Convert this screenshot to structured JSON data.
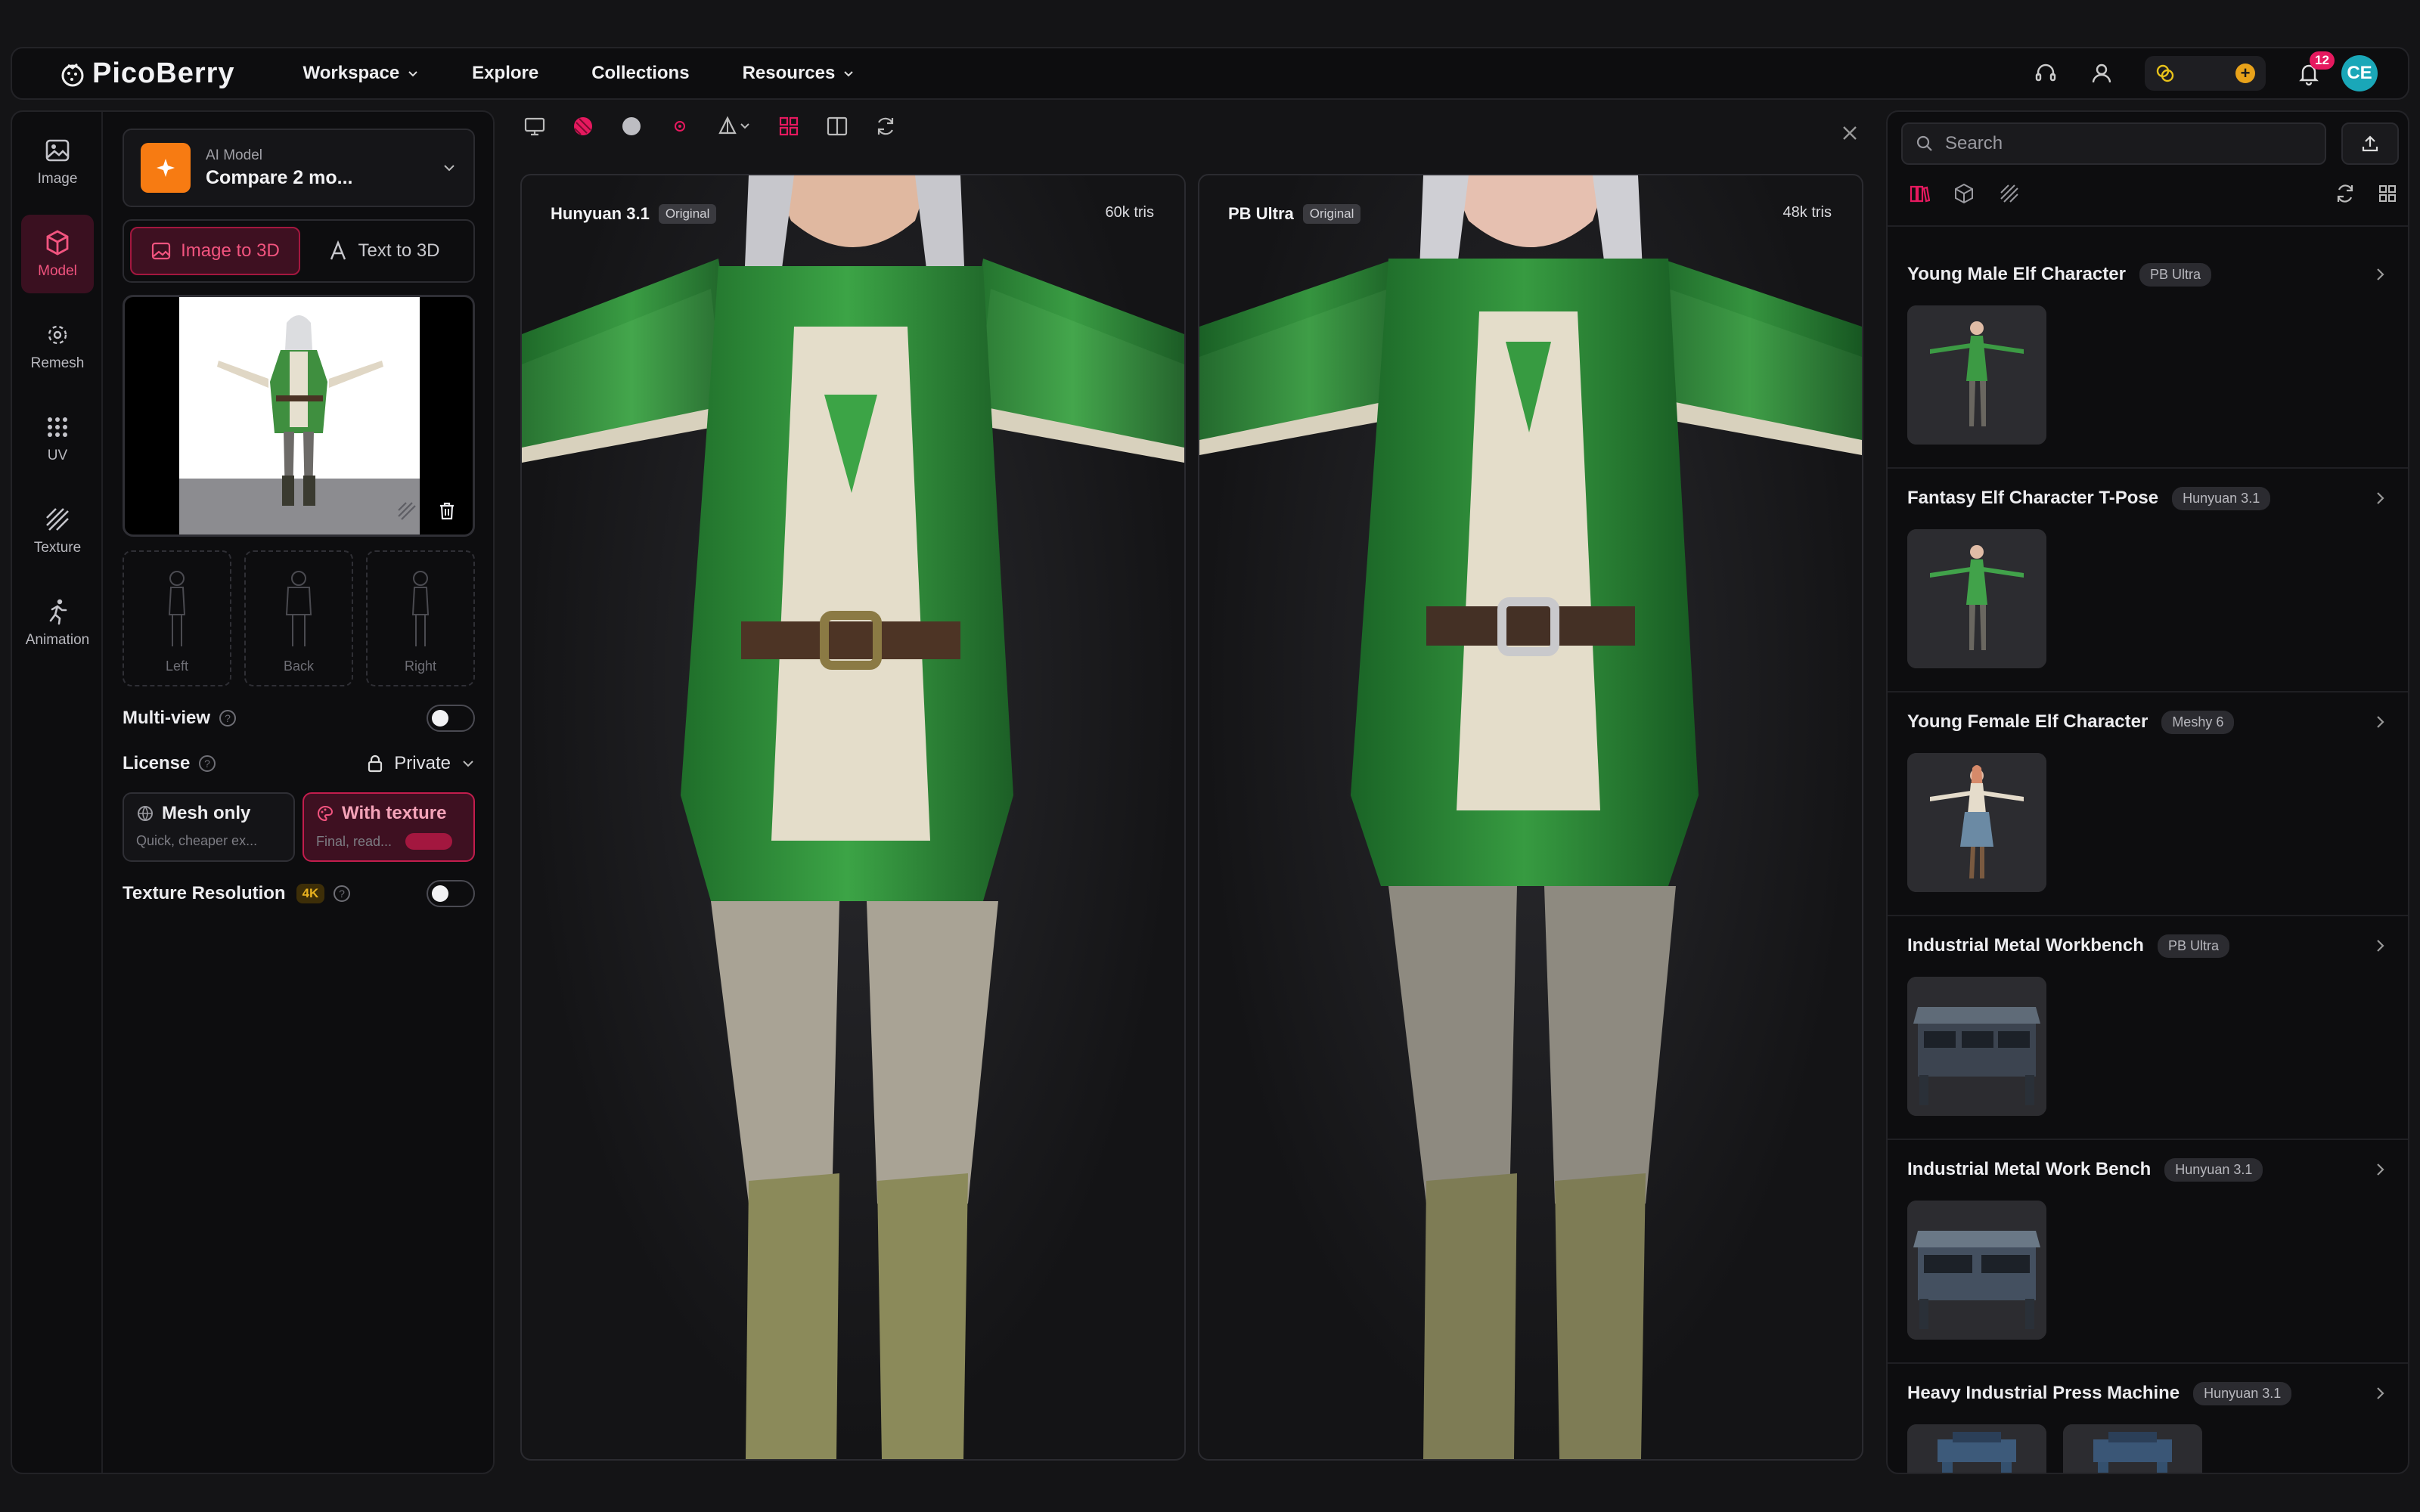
{
  "header": {
    "brand": "PicoBerry",
    "nav": [
      {
        "label": "Workspace",
        "dropdown": true
      },
      {
        "label": "Explore",
        "dropdown": false
      },
      {
        "label": "Collections",
        "dropdown": false
      },
      {
        "label": "Resources",
        "dropdown": true
      }
    ],
    "notifications_count": "12",
    "avatar_initials": "CE",
    "icons": [
      "headset-icon",
      "user-icon",
      "coin-icon",
      "plus-icon",
      "bell-icon"
    ]
  },
  "rail": {
    "items": [
      {
        "label": "Image",
        "icon": "image-icon",
        "active": false
      },
      {
        "label": "Model",
        "icon": "cube-icon",
        "active": true
      },
      {
        "label": "Remesh",
        "icon": "remesh-icon",
        "active": false
      },
      {
        "label": "UV",
        "icon": "grid-dots-icon",
        "active": false
      },
      {
        "label": "Texture",
        "icon": "texture-icon",
        "active": false
      },
      {
        "label": "Animation",
        "icon": "running-icon",
        "active": false
      }
    ]
  },
  "panel": {
    "model_small": "AI Model",
    "model_value": "Compare 2 mo...",
    "mode_image": "Image to 3D",
    "mode_text": "Text to 3D",
    "views": [
      "Left",
      "Back",
      "Right"
    ],
    "multiview_label": "Multi-view",
    "license_label": "License",
    "license_value": "Private",
    "mesh_only_title": "Mesh only",
    "mesh_only_desc": "Quick, cheaper ex...",
    "with_texture_title": "With texture",
    "with_texture_desc": "Final, read...",
    "texture_res_label": "Texture Resolution",
    "texture_res_badge": "4K"
  },
  "viewer": {
    "left": {
      "name": "Hunyuan 3.1",
      "tag": "Original",
      "tris": "60k tris"
    },
    "right": {
      "name": "PB Ultra",
      "tag": "Original",
      "tris": "48k tris"
    }
  },
  "library": {
    "search_placeholder": "Search",
    "items": [
      {
        "title": "Young Male Elf Character",
        "badge": "PB Ultra",
        "thumb": "elf-male"
      },
      {
        "title": "Fantasy Elf Character T-Pose",
        "badge": "Hunyuan 3.1",
        "thumb": "elf-male"
      },
      {
        "title": "Young Female Elf Character",
        "badge": "Meshy 6",
        "thumb": "elf-female"
      },
      {
        "title": "Industrial Metal Workbench",
        "badge": "PB Ultra",
        "thumb": "bench"
      },
      {
        "title": "Industrial Metal Work Bench",
        "badge": "Hunyuan 3.1",
        "thumb": "bench"
      },
      {
        "title": "Heavy Industrial Press Machine",
        "badge": "Hunyuan 3.1",
        "thumb": "press"
      }
    ]
  },
  "colors": {
    "accent": "#e6195f",
    "model_badge": "#f77b12",
    "avatar": "#1aa7b8",
    "elf_green": "#2f8f3a"
  }
}
